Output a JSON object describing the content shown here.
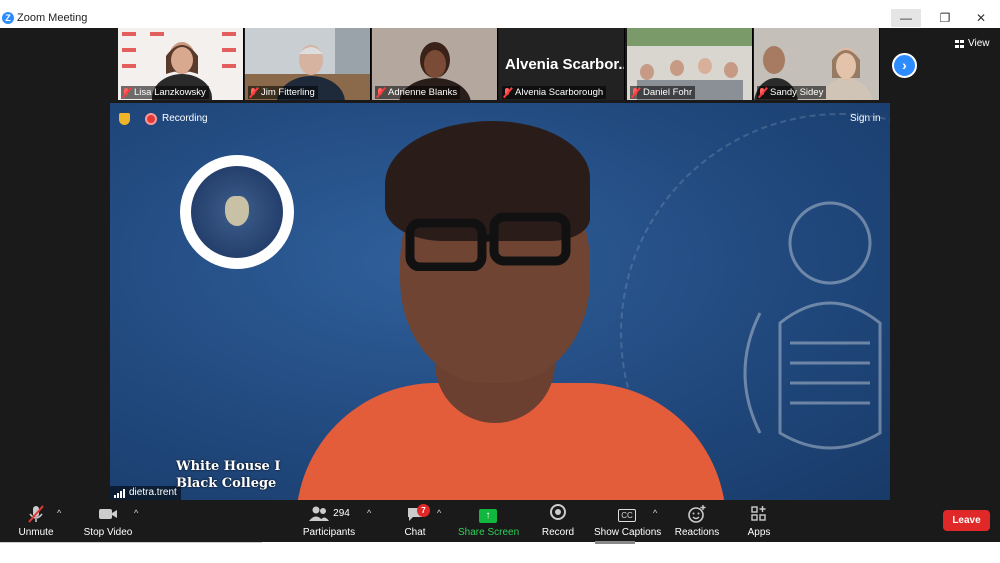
{
  "window": {
    "title": "Zoom Meeting",
    "logo_glyph": "Z",
    "minimize_glyph": "—",
    "maximize_glyph": "❐",
    "close_glyph": "✕"
  },
  "top_bar": {
    "view_label": "View",
    "next_glyph": "›"
  },
  "participants_strip": [
    {
      "name": "Lisa Lanzkowsky",
      "muted": true
    },
    {
      "name": "Jim Fitterling",
      "muted": true
    },
    {
      "name": "Adrienne Blanks",
      "muted": true
    },
    {
      "name": "Alvenia Scarborough",
      "display_name": "Alvenia  Scarbor...",
      "muted": true
    },
    {
      "name": "Daniel Fohr",
      "muted": true
    },
    {
      "name": "Sandy Sidey",
      "muted": true
    }
  ],
  "main_video": {
    "recording_label": "Recording",
    "sign_in_label": "Sign in",
    "speaker_name": "dietra.trent",
    "background_text_line1": "White House I",
    "background_text_line2": "Black College"
  },
  "toolbar": {
    "unmute": {
      "label": "Unmute",
      "icon": "mic-muted-icon"
    },
    "stop_video": {
      "label": "Stop Video",
      "icon": "video-camera-icon"
    },
    "participants": {
      "label": "Participants",
      "count": "294",
      "icon": "participants-icon"
    },
    "chat": {
      "label": "Chat",
      "badge": "7",
      "icon": "chat-icon"
    },
    "share_screen": {
      "label": "Share Screen",
      "icon": "share-screen-icon"
    },
    "record": {
      "label": "Record",
      "icon": "record-icon"
    },
    "show_captions": {
      "label": "Show Captions",
      "cc_text": "CC",
      "icon": "captions-icon"
    },
    "reactions": {
      "label": "Reactions",
      "icon": "reactions-icon"
    },
    "apps": {
      "label": "Apps",
      "icon": "apps-icon"
    },
    "leave": {
      "label": "Leave"
    },
    "caret_glyph": "^"
  },
  "colors": {
    "accent": "#2d8cff",
    "share_green": "#12b83e",
    "leave_red": "#e02828",
    "toolbar_bg": "#1a1a1a"
  }
}
